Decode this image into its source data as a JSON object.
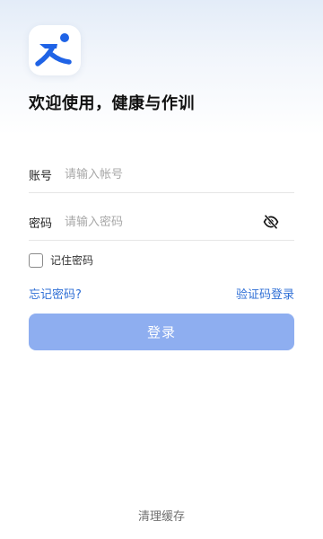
{
  "app": {
    "logo_icon": "app-logo-icon",
    "brand_colors": {
      "primary": "#2f6fd6",
      "logo_blue": "#1f63e6",
      "logo_dot": "#1f63e6"
    }
  },
  "header": {
    "title": "欢迎使用，健康与作训"
  },
  "form": {
    "account": {
      "label": "账号",
      "placeholder": "请输入帐号",
      "value": ""
    },
    "password": {
      "label": "密码",
      "placeholder": "请输入密码",
      "value": "",
      "toggle_icon": "eye-off-icon"
    },
    "remember": {
      "label": "记住密码",
      "checked": false
    }
  },
  "links": {
    "forgot_password": "忘记密码?",
    "sms_login": "验证码登录"
  },
  "actions": {
    "login_label": "登录",
    "login_color": "#8eaef0"
  },
  "footer": {
    "clear_cache": "清理缓存"
  }
}
